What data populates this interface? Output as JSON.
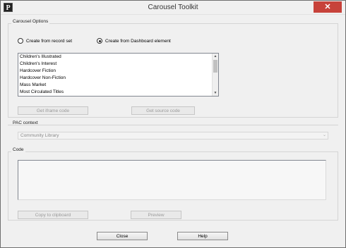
{
  "window": {
    "title": "Carousel Toolkit",
    "close_glyph": "✕"
  },
  "carousel_options": {
    "group_label": "Carousel Options",
    "radio_record_set": "Create from record set",
    "radio_dashboard": "Create from Dashboard element",
    "selected": "dashboard",
    "items": [
      "Children's Illustrated",
      "Children's Interest",
      "Hardcover Fiction",
      "Hardcover Non-Fiction",
      "Mass Market",
      "Most Circulated Titles"
    ],
    "get_iframe_label": "Get iframe code",
    "get_source_label": "Get source code"
  },
  "pac_context": {
    "label": "PAC context",
    "value": "Community Library"
  },
  "code": {
    "label": "Code",
    "copy_label": "Copy to clipboard",
    "preview_label": "Preview"
  },
  "footer": {
    "close_label": "Close",
    "help_label": "Help"
  }
}
